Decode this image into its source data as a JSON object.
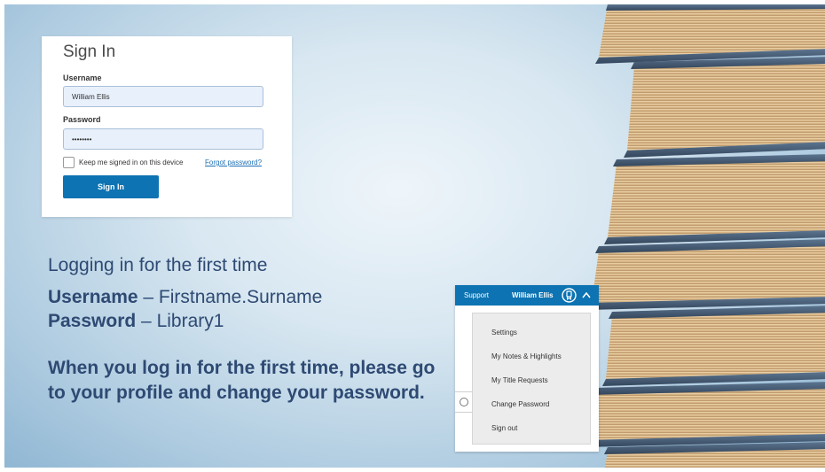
{
  "signin": {
    "title": "Sign In",
    "username_label": "Username",
    "username_value": "William Ellis",
    "password_label": "Password",
    "password_value": "••••••••",
    "keep_signed_in": "Keep me signed in on this device",
    "forgot_password": "Forgot password?",
    "button": "Sign In"
  },
  "slide": {
    "heading": "Logging in for the first time",
    "username_label": "Username",
    "username_value": " – Firstname.Surname",
    "password_label": "Password",
    "password_value": " – Library1",
    "instruction": "When you log in for the first time, please go to your profile and change your password."
  },
  "account": {
    "support": "Support",
    "user_name": "William Ellis",
    "menu": [
      {
        "label": "Settings"
      },
      {
        "label": "My Notes & Highlights"
      },
      {
        "label": "My Title Requests"
      },
      {
        "label": "Change Password"
      },
      {
        "label": "Sign out"
      }
    ]
  },
  "colors": {
    "brand_blue": "#0d73b2",
    "heading_text": "#2e4a73",
    "field_bg": "#e8f0fb"
  }
}
